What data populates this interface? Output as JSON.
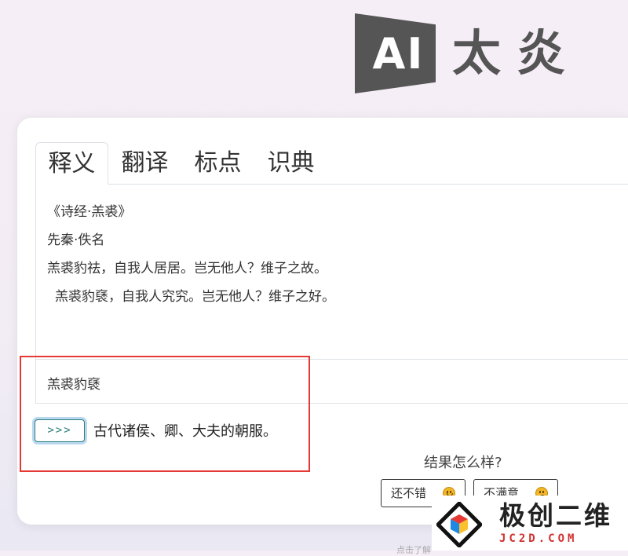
{
  "logo": {
    "mark_text": "AI",
    "name": "太炎"
  },
  "tabs": [
    {
      "label": "释义",
      "active": true
    },
    {
      "label": "翻译",
      "active": false
    },
    {
      "label": "标点",
      "active": false
    },
    {
      "label": "识典",
      "active": false
    }
  ],
  "content": {
    "title": "《诗经·羔裘》",
    "author": "先秦·佚名",
    "lines": [
      "羔裘豹祛，自我人居居。岂无他人？维子之故。",
      "羔裘豹褎，自我人究究。岂无他人？维子之好。"
    ]
  },
  "query": {
    "text": "羔裘豹褎"
  },
  "result": {
    "button_label": ">>>",
    "text": "古代诸侯、卿、大夫的朝服。"
  },
  "feedback": {
    "question": "结果怎么样?",
    "good_label": "还不错",
    "bad_label": "不满意"
  },
  "footer": {
    "text": "点击了解"
  },
  "watermark": {
    "title": "极创二维",
    "subtitle": "JC2D.COM"
  },
  "colors": {
    "accent": "#2a7d7b",
    "highlight": "#e53935",
    "watermark_red": "#d32f2f"
  }
}
